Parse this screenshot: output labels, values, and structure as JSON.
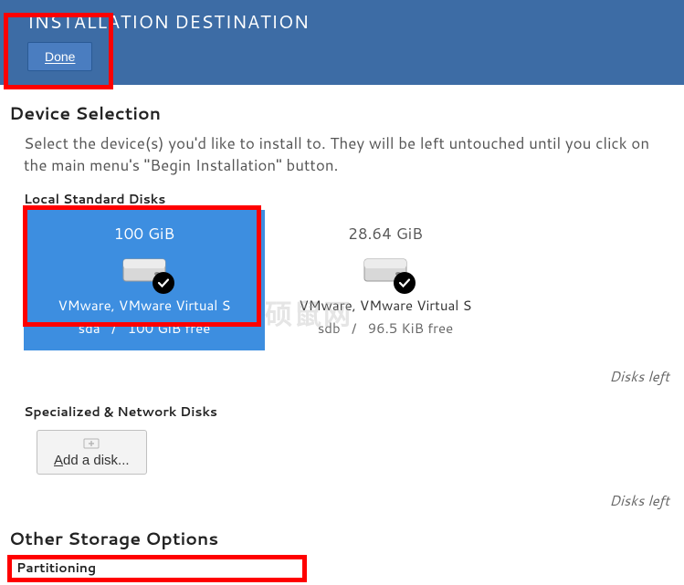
{
  "header": {
    "title": "INSTALLATION DESTINATION",
    "done_button": "Done"
  },
  "device_selection": {
    "title": "Device Selection",
    "description": "Select the device(s) you'd like to install to.  They will be left untouched until you click on the main menu's \"Begin Installation\" button.",
    "local_disks_label": "Local Standard Disks",
    "disks": [
      {
        "size": "100 GiB",
        "name": "VMware, VMware Virtual S",
        "dev": "sda",
        "sep": "/",
        "free": "100 GiB free",
        "selected": true
      },
      {
        "size": "28.64 GiB",
        "name": "VMware, VMware Virtual S",
        "dev": "sdb",
        "sep": "/",
        "free": "96.5 KiB free",
        "selected": false
      }
    ],
    "disks_footer": "Disks left"
  },
  "specialized": {
    "label": "Specialized & Network Disks",
    "add_button": "Add a disk...",
    "footer": "Disks left"
  },
  "other_storage": {
    "title": "Other Storage Options",
    "partitioning_label": "Partitioning"
  },
  "watermark": "硕鼠网"
}
